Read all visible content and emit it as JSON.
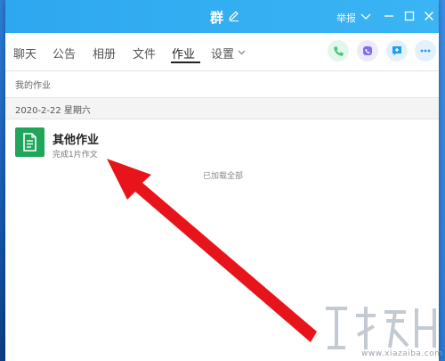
{
  "window": {
    "title": "群",
    "report_label": "举报"
  },
  "tabs": [
    {
      "label": "聊天"
    },
    {
      "label": "公告"
    },
    {
      "label": "相册"
    },
    {
      "label": "文件"
    },
    {
      "label": "作业"
    },
    {
      "label": "设置"
    }
  ],
  "active_tab": "作业",
  "homework": {
    "section_title": "我的作业",
    "date": "2020-2-22 星期六",
    "items": [
      {
        "title": "其他作业",
        "subtitle": "完成1片作文"
      }
    ],
    "footer": "已加载全部"
  },
  "watermark": {
    "url": "www.xiazaiba.com"
  },
  "colors": {
    "titlebar": "#2ea7f0",
    "homework_icon": "#1fa65a",
    "arrow": "#e8141b",
    "call_button": "#3ec97a",
    "video_button": "#7b6ff0",
    "msg_button": "#1e9cf0"
  }
}
